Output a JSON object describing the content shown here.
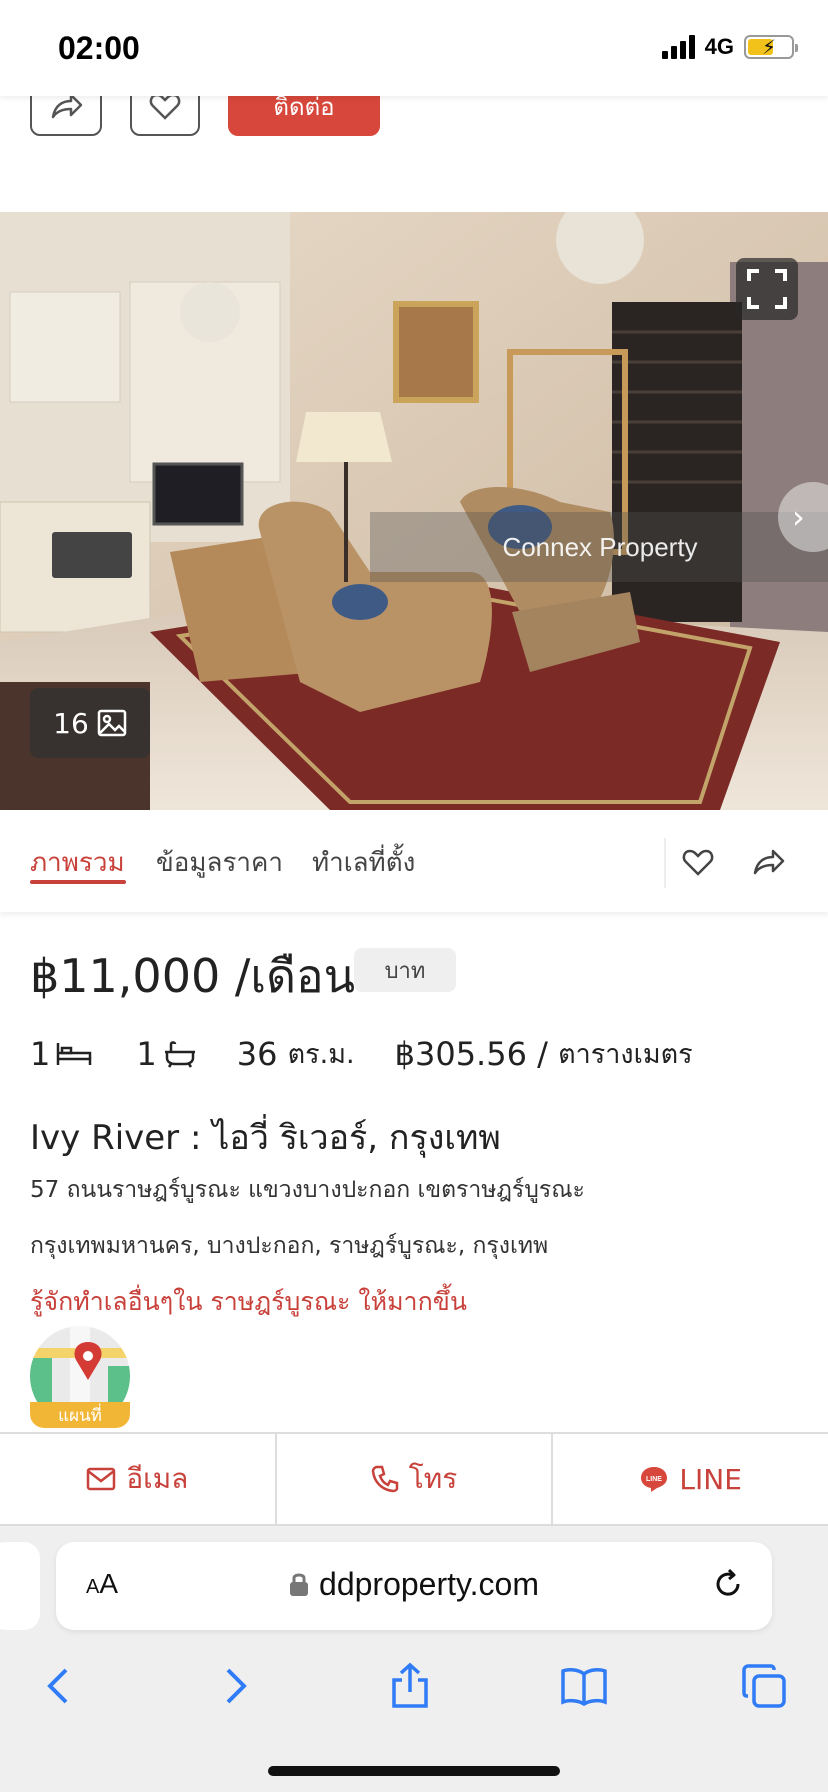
{
  "status": {
    "time": "02:00",
    "network": "4G",
    "battery_percent": 60
  },
  "top_actions": {
    "contact_label": "ติดต่อ"
  },
  "gallery": {
    "watermark": "Connex Property",
    "photo_count": "16"
  },
  "tabs": [
    {
      "label": "ภาพรวม",
      "active": true
    },
    {
      "label": "ข้อมูลราคา",
      "active": false
    },
    {
      "label": "ทำเลที่ตั้ง",
      "active": false
    }
  ],
  "listing": {
    "price": "฿11,000 /เดือน",
    "currency_badge": "บาท",
    "bedrooms": "1",
    "bathrooms": "1",
    "area_value": "36",
    "area_unit": "ตร.ม.",
    "price_per_sqm": "฿305.56 /",
    "price_per_sqm_unit": "ตารางเมตร",
    "title": "Ivy River : ไอวี่ ริเวอร์, กรุงเทพ",
    "address_line1": "57 ถนนราษฎร์บูรณะ แขวงบางปะกอก เขตราษฎร์บูรณะ",
    "address_line2": "กรุงเทพมหานคร, บางปะกอก, ราษฎร์บูรณะ, กรุงเทพ",
    "area_link": "รู้จักทำเลอื่นๆใน ราษฎร์บูรณะ ให้มากขึ้น",
    "map_label": "แผนที่"
  },
  "contact_bar": {
    "email": "อีเมล",
    "call": "โทร",
    "line": "LINE"
  },
  "browser": {
    "aa_label": "AA",
    "url": "ddproperty.com"
  },
  "colors": {
    "accent": "#c8413a",
    "contact_button": "#d7473b",
    "safari_blue": "#2f7cf6"
  }
}
